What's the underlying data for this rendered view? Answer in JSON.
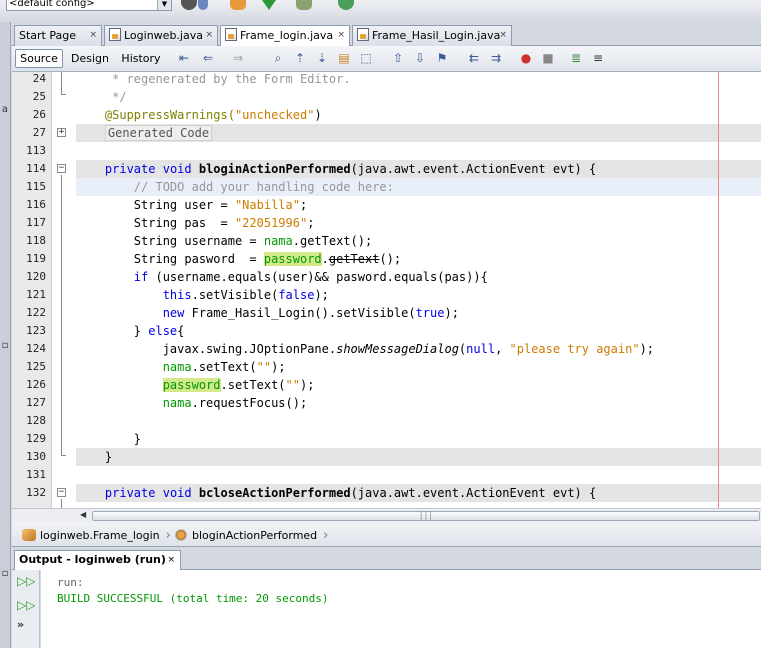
{
  "toolbar": {
    "config_value": "<default config>"
  },
  "tabs": [
    {
      "label": "Start Page",
      "close": "×"
    },
    {
      "label": "Loginweb.java",
      "close": "×"
    },
    {
      "label": "Frame_login.java",
      "close": "×"
    },
    {
      "label": "Frame_Hasil_Login.java",
      "close": "×"
    }
  ],
  "editor_toolbar": {
    "source_label": "Source",
    "design_label": "Design",
    "history_label": "History"
  },
  "code": {
    "line_numbers": [
      "24",
      "25",
      "26",
      "27",
      "113",
      "114",
      "115",
      "116",
      "117",
      "118",
      "119",
      "120",
      "121",
      "122",
      "123",
      "124",
      "125",
      "126",
      "127",
      "128",
      "129",
      "130",
      "131",
      "132"
    ],
    "l24": " * regenerated by the Form Editor.",
    "l25": " */",
    "l26_annotation": "@SuppressWarnings(",
    "l26_str": "\"unchecked\"",
    "l26_end": ")",
    "l27_fold": "Generated Code",
    "l114_kw1": "private",
    "l114_kw2": "void",
    "l114_name": "bloginActionPerformed",
    "l114_rest": "(java.awt.event.ActionEvent evt) {",
    "l115": "// TODO add your handling code here:",
    "l116_a": "String user = ",
    "l116_s": "\"Nabilla\"",
    "l116_b": ";",
    "l117_a": "String pas  = ",
    "l117_s": "\"22051996\"",
    "l117_b": ";",
    "l118_a": "String username = ",
    "l118_f": "nama",
    "l118_b": ".getText();",
    "l119_a": "String pasword  = ",
    "l119_f": "password",
    "l119_dot": ".",
    "l119_m": "getText",
    "l119_b": "();",
    "l120_kw": "if",
    "l120_a": " (username.equals(user)&& pasword.equals(pas)){",
    "l121_kw": "this",
    "l121_a": ".setVisible(",
    "l121_kw2": "false",
    "l121_b": ");",
    "l122_kw": "new",
    "l122_a": " Frame_Hasil_Login().setVisible(",
    "l122_kw2": "true",
    "l122_b": ");",
    "l123_a": "} ",
    "l123_kw": "else",
    "l123_b": "{",
    "l124_a": "javax.swing.JOptionPane.",
    "l124_m": "showMessageDialog",
    "l124_b": "(",
    "l124_kw": "null",
    "l124_c": ", ",
    "l124_s": "\"please try again\"",
    "l124_d": ");",
    "l125_f": "nama",
    "l125_a": ".setText(",
    "l125_s": "\"\"",
    "l125_b": ");",
    "l126_f": "password",
    "l126_a": ".setText(",
    "l126_s": "\"\"",
    "l126_b": ");",
    "l127_f": "nama",
    "l127_a": ".requestFocus();",
    "l129": "}",
    "l130": "}",
    "l132_kw1": "private",
    "l132_kw2": "void",
    "l132_name": "bcloseActionPerformed",
    "l132_rest": "(java.awt.event.ActionEvent evt) {"
  },
  "navbar": {
    "crumb1": "loginweb.Frame_login",
    "crumb2": "bloginActionPerformed"
  },
  "output": {
    "tab_label": "Output - loginweb (run)",
    "close": "×",
    "line1": "run:",
    "line2": "BUILD SUCCESSFUL (total time: 20 seconds)",
    "more": "»"
  },
  "colors": {
    "keyword": "#0000e6",
    "string": "#ce7b00",
    "comment": "#969696",
    "field": "#009900",
    "build_success": "#009900",
    "margin_line": "#f08888"
  }
}
